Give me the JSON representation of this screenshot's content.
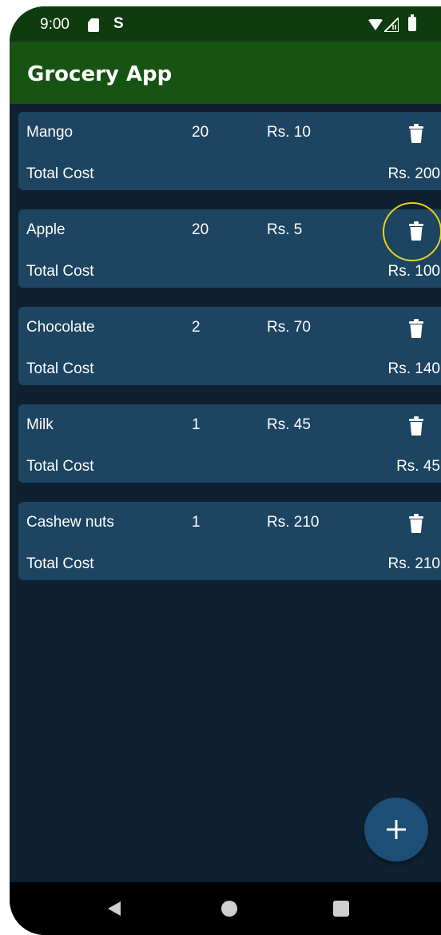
{
  "status_bar": {
    "time": "9:00",
    "s_glyph": "S"
  },
  "app": {
    "title": "Grocery App"
  },
  "items": [
    {
      "name": "Mango",
      "quantity": "20",
      "price": "Rs. 10",
      "total_label": "Total Cost",
      "total": "Rs. 200"
    },
    {
      "name": "Apple",
      "quantity": "20",
      "price": "Rs. 5",
      "total_label": "Total Cost",
      "total": "Rs. 100"
    },
    {
      "name": "Chocolate",
      "quantity": "2",
      "price": "Rs. 70",
      "total_label": "Total Cost",
      "total": "Rs. 140"
    },
    {
      "name": "Milk",
      "quantity": "1",
      "price": "Rs. 45",
      "total_label": "Total Cost",
      "total": "Rs. 45"
    },
    {
      "name": "Cashew nuts",
      "quantity": "1",
      "price": "Rs. 210",
      "total_label": "Total Cost",
      "total": "Rs. 210"
    }
  ],
  "icons": {
    "delete": "trash-icon",
    "fab": "plus-icon",
    "nav_back": "back-triangle-icon",
    "nav_home": "home-circle-icon",
    "nav_recents": "recents-square-icon"
  },
  "colors": {
    "status_bar": "#0f3b0e",
    "app_bar": "#175313",
    "background": "#0f2130",
    "card": "#1d4460",
    "fab": "#1d4e77",
    "touch_indicator": "#e7d21c"
  }
}
